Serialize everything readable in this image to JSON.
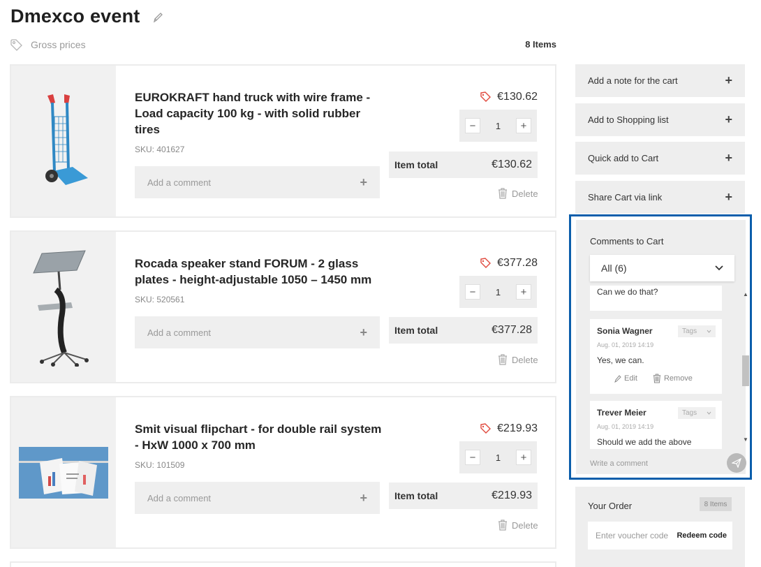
{
  "header": {
    "title": "Dmexco event",
    "price_mode": "Gross prices",
    "items_count": "8 Items"
  },
  "products": [
    {
      "name": "EUROKRAFT hand truck with wire frame - Load capacity 100 kg - with solid rubber tires",
      "sku": "SKU: 401627",
      "price": "€130.62",
      "quantity": "1",
      "total_label": "Item total",
      "total": "€130.62",
      "comment_placeholder": "Add a comment",
      "delete_label": "Delete"
    },
    {
      "name": "Rocada speaker stand FORUM - 2 glass plates - height-adjustable 1050 – 1450 mm",
      "sku": "SKU: 520561",
      "price": "€377.28",
      "quantity": "1",
      "total_label": "Item total",
      "total": "€377.28",
      "comment_placeholder": "Add a comment",
      "delete_label": "Delete"
    },
    {
      "name": "Smit visual flipchart - for double rail system - HxW 1000 x 700 mm",
      "sku": "SKU: 101509",
      "price": "€219.93",
      "quantity": "1",
      "total_label": "Item total",
      "total": "€219.93",
      "comment_placeholder": "Add a comment",
      "delete_label": "Delete"
    }
  ],
  "sidebar": {
    "actions": [
      {
        "label": "Add a note for the cart"
      },
      {
        "label": "Add to Shopping list"
      },
      {
        "label": "Quick add to Cart"
      },
      {
        "label": "Share Cart via link"
      }
    ],
    "comments": {
      "title": "Comments to Cart",
      "filter": "All (6)",
      "partial_text": "Can we do that?",
      "items": [
        {
          "author": "Sonia Wagner",
          "tags": "Tags",
          "date": "Aug. 01, 2019 14:19",
          "text": "Yes, we can.",
          "edit": "Edit",
          "remove": "Remove"
        },
        {
          "author": "Trever Meier",
          "tags": "Tags",
          "date": "Aug. 01, 2019 14:19",
          "text": "Should we add the above"
        }
      ],
      "write_placeholder": "Write a comment"
    },
    "order": {
      "title": "Your Order",
      "badge": "8 Items",
      "voucher_placeholder": "Enter voucher code",
      "redeem_label": "Redeem code"
    }
  },
  "colors": {
    "accent_border": "#0b5eab",
    "price_tag": "#e0483c"
  }
}
